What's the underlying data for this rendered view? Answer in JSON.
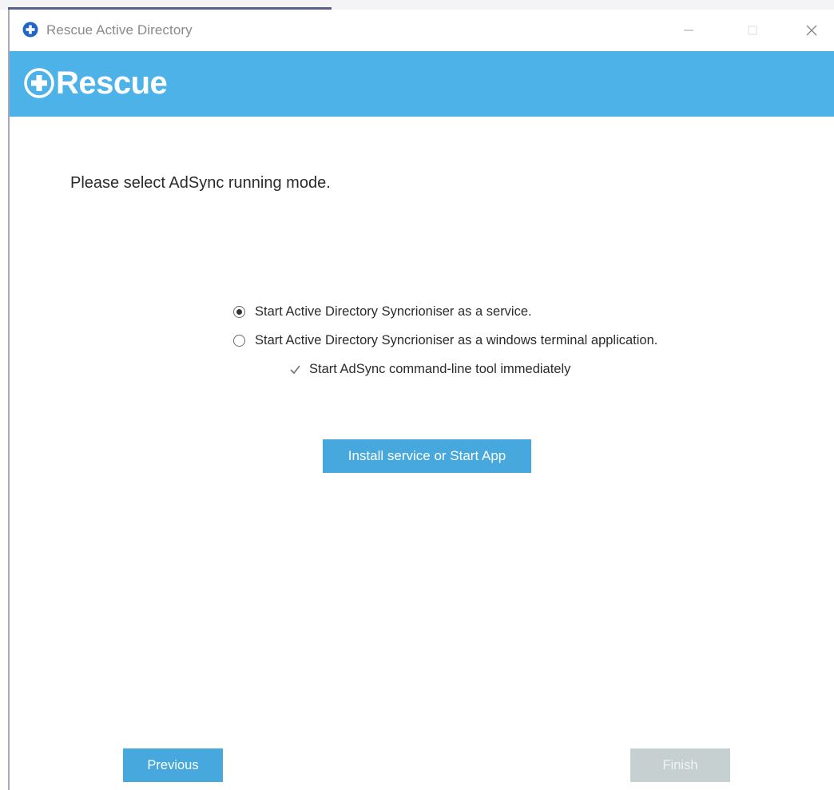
{
  "window": {
    "title": "Rescue Active Directory",
    "controls": {
      "minimize": "minimize-icon",
      "maximize": "maximize-icon",
      "close": "close-icon"
    }
  },
  "banner": {
    "brand": "Rescue",
    "color": "#4cb2e8"
  },
  "content": {
    "prompt": "Please select AdSync running mode.",
    "options": [
      {
        "label": "Start Active Directory Syncrioniser as a service.",
        "selected": true
      },
      {
        "label": "Start Active Directory Syncrioniser as a windows terminal application.",
        "selected": false
      }
    ],
    "checkbox": {
      "label": "Start AdSync command-line tool immediately",
      "checked": true,
      "enabled": false
    },
    "action_button": "Install service or Start App"
  },
  "footer": {
    "previous_label": "Previous",
    "finish_label": "Finish",
    "finish_enabled": false
  },
  "colors": {
    "accent": "#46a8dd",
    "disabled": "#c6d0d0"
  }
}
